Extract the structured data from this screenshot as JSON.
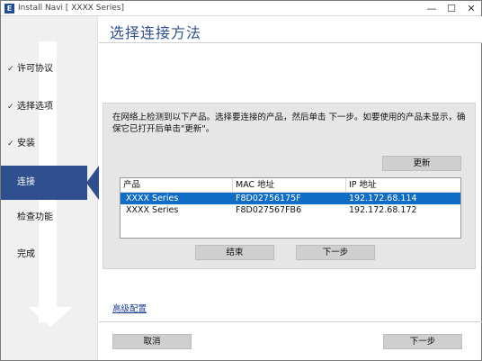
{
  "window": {
    "icon_text": "E",
    "title": "Install Navi [ XXXX Series]",
    "minimize_glyph": "—",
    "maximize_glyph": "☐",
    "close_glyph": "✕"
  },
  "sidebar": {
    "check_glyph": "✓",
    "items": [
      {
        "label": "许可协议",
        "done": true
      },
      {
        "label": "选择选项",
        "done": true
      },
      {
        "label": "安装",
        "done": true
      },
      {
        "label": "连接",
        "active": true
      },
      {
        "label": "检查功能"
      },
      {
        "label": "完成"
      }
    ]
  },
  "page": {
    "title": "选择连接方法",
    "instructions": "在网络上检测到以下产品。选择要连接的产品，然后单击 下一步。如要使用的产品未显示，确保它已打开后单击\"更新\"。",
    "refresh_label": "更新",
    "finish_label": "结束",
    "next_inner_label": "下一步",
    "advanced_link": "高级配置"
  },
  "table": {
    "columns": [
      "产品",
      "MAC 地址",
      "IP 地址"
    ],
    "rows": [
      {
        "product": "XXXX  Series",
        "mac": "F8D02756175F",
        "ip": "192.172.68.114",
        "selected": true
      },
      {
        "product": "XXXX  Series",
        "mac": "F8D027567FB6",
        "ip": "192.172.68.172",
        "selected": false
      }
    ]
  },
  "footer": {
    "cancel_label": "取消",
    "next_label": "下一步"
  },
  "colors": {
    "accent": "#2f4f8e",
    "selection": "#0f6dc5",
    "link": "#1a3e9a",
    "sidebar_bg": "#f0f0f0",
    "panel_bg": "#e6e6e6",
    "button_bg": "#cfcfcf"
  }
}
